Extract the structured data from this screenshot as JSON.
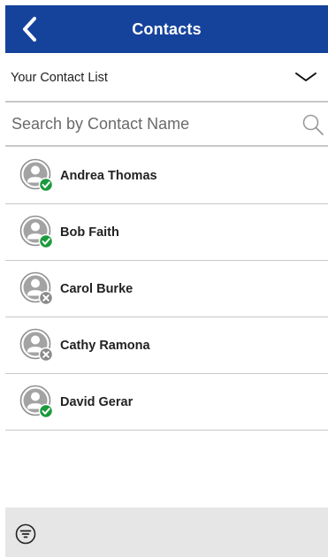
{
  "header": {
    "title": "Contacts",
    "back_icon": "chevron-left-icon",
    "background_color": "#15439c"
  },
  "list_selector": {
    "label": "Your Contact List",
    "icon": "chevron-down-icon"
  },
  "search": {
    "placeholder": "Search by Contact Name",
    "value": "",
    "icon": "search-icon"
  },
  "contacts": [
    {
      "name": "Andrea Thomas",
      "status": "online"
    },
    {
      "name": "Bob Faith",
      "status": "online"
    },
    {
      "name": "Carol Burke",
      "status": "offline"
    },
    {
      "name": "Cathy Ramona",
      "status": "offline"
    },
    {
      "name": "David Gerar",
      "status": "online"
    }
  ],
  "status_colors": {
    "online": "#1a9a3c",
    "offline": "#8a8a8a"
  },
  "footer": {
    "filter_icon": "filter-icon"
  }
}
